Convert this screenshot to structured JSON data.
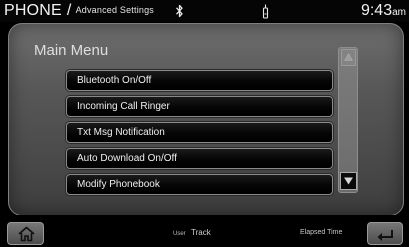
{
  "header": {
    "title": "PHONE",
    "separator": "/",
    "subtitle": "Advanced Settings",
    "time": "9:43",
    "ampm": "am"
  },
  "panel": {
    "title": "Main Menu"
  },
  "menu": {
    "items": [
      {
        "label": "Bluetooth On/Off"
      },
      {
        "label": "Incoming Call Ringer"
      },
      {
        "label": "Txt Msg Notification"
      },
      {
        "label": "Auto Download On/Off"
      },
      {
        "label": "Modify Phonebook"
      }
    ]
  },
  "footer": {
    "user_label": "User",
    "track_label": "Track",
    "elapsed_label": "Elapsed Time"
  },
  "icons": {
    "bluetooth": "bluetooth-icon",
    "phone": "phone-signal-icon",
    "home": "home-icon",
    "back": "back-arrow-icon",
    "scroll_up": "scroll-up-arrow-icon",
    "scroll_down": "scroll-down-arrow-icon"
  },
  "colors": {
    "panel": "#5a5a5a",
    "button_bg": "#050505",
    "button_border": "#8a8a8a",
    "text": "#f0f0f0"
  }
}
